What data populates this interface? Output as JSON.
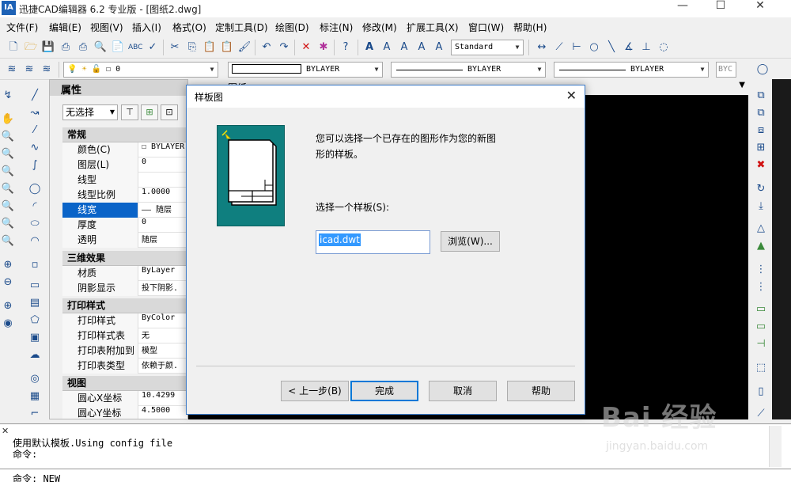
{
  "app": {
    "logo": "IA",
    "title": "迅捷CAD编辑器 6.2 专业版  - [图纸2.dwg]"
  },
  "window_controls": {
    "minimize": "—",
    "maximize": "☐",
    "close": "✕"
  },
  "menubar": {
    "items": [
      "文件(F)",
      "编辑(E)",
      "视图(V)",
      "插入(I)",
      "格式(O)",
      "定制工具(D)",
      "绘图(D)",
      "标注(N)",
      "修改(M)",
      "扩展工具(X)",
      "窗口(W)",
      "帮助(H)"
    ]
  },
  "toolbar1": {
    "text_style": "Standard"
  },
  "toolbar2": {
    "layer_value": "0",
    "color_value": "BYLAYER",
    "linetype_value": "BYLAYER",
    "lineweight_value": "BYLAYER",
    "plotstyle_value": "BYC"
  },
  "properties": {
    "title": "属性",
    "selection": "无选择",
    "sections": [
      {
        "name": "常规",
        "rows": [
          {
            "key": "颜色(C)",
            "value": "☐ BYLAYER"
          },
          {
            "key": "图层(L)",
            "value": "0"
          },
          {
            "key": "线型",
            "value": ""
          },
          {
            "key": "线型比例",
            "value": "1.0000"
          },
          {
            "key": "线宽",
            "value": "—— 随层"
          },
          {
            "key": "厚度",
            "value": "0"
          },
          {
            "key": "透明",
            "value": "随层"
          }
        ]
      },
      {
        "name": "三维效果",
        "rows": [
          {
            "key": "材质",
            "value": "ByLayer"
          },
          {
            "key": "阴影显示",
            "value": "投下阴影."
          }
        ]
      },
      {
        "name": "打印样式",
        "rows": [
          {
            "key": "打印样式",
            "value": "ByColor"
          },
          {
            "key": "打印样式表",
            "value": "无"
          },
          {
            "key": "打印表附加到",
            "value": "模型"
          },
          {
            "key": "打印表类型",
            "value": "依赖于颜."
          }
        ]
      },
      {
        "name": "视图",
        "rows": [
          {
            "key": "圆心X坐标",
            "value": "10.4299"
          },
          {
            "key": "圆心Y坐标",
            "value": "4.5000"
          }
        ]
      }
    ]
  },
  "drawing_tab": "图纸",
  "dialog": {
    "title": "样板图",
    "description": "您可以选择一个已存在的图形作为您的新图形的样板。",
    "description_line1": "您可以选择一个已存在的图形作为您的新图",
    "description_line2": "形的样板。",
    "select_label": "选择一个样板(S):",
    "template_value": "icad.dwt",
    "browse_button": "浏览(W)...",
    "back_button": "< 上一步(B)",
    "finish_button": "完成",
    "cancel_button": "取消",
    "help_button": "帮助"
  },
  "command": {
    "line1": "使用默认模板.Using config file",
    "line2": "命令:",
    "line3": "命令:   NEW"
  },
  "watermark": {
    "text": "Bai 经验",
    "url": "jingyan.baidu.com"
  }
}
